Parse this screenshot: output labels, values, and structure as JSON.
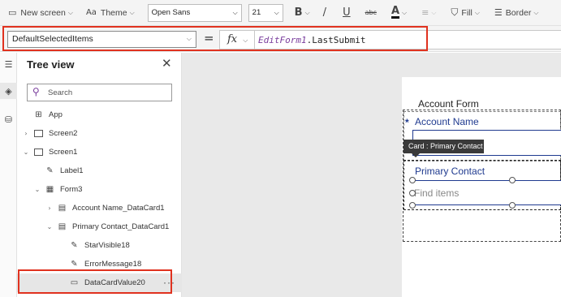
{
  "toolbar": {
    "new_screen": "New screen",
    "theme": "Theme",
    "font_name": "Open Sans",
    "font_size": "21",
    "bold_glyph": "B",
    "italic_glyph": "/",
    "underline_glyph": "U",
    "strike_glyph": "abc",
    "font_color_glyph": "A",
    "fill": "Fill",
    "border": "Border"
  },
  "formula_bar": {
    "property": "DefaultSelectedItems",
    "equals": "=",
    "fx_label": "fx",
    "formula_identifier": "EditForm1",
    "formula_rest": ".LastSubmit"
  },
  "tree_view": {
    "title": "Tree view",
    "search_placeholder": "Search",
    "items": [
      {
        "label": "App",
        "icon": "app-icon",
        "level": 0,
        "chevron": ""
      },
      {
        "label": "Screen2",
        "icon": "screen-icon",
        "level": 0,
        "chevron": "›"
      },
      {
        "label": "Screen1",
        "icon": "screen-icon",
        "level": 0,
        "chevron": "⌄"
      },
      {
        "label": "Label1",
        "icon": "label-icon",
        "level": 1,
        "chevron": ""
      },
      {
        "label": "Form3",
        "icon": "form-icon",
        "level": 1,
        "chevron": "⌄"
      },
      {
        "label": "Account Name_DataCard1",
        "icon": "card-icon",
        "level": 2,
        "chevron": "›"
      },
      {
        "label": "Primary Contact_DataCard1",
        "icon": "card-icon",
        "level": 2,
        "chevron": "⌄"
      },
      {
        "label": "StarVisible18",
        "icon": "label-icon",
        "level": 3,
        "chevron": ""
      },
      {
        "label": "ErrorMessage18",
        "icon": "label-icon",
        "level": 3,
        "chevron": ""
      },
      {
        "label": "DataCardValue20",
        "icon": "combobox-icon",
        "level": 3,
        "chevron": "",
        "selected": true
      }
    ],
    "more": "···"
  },
  "canvas": {
    "form_title": "Account Form",
    "required_star": "*",
    "account_name_label": "Account Name",
    "tooltip": "Card : Primary Contact",
    "primary_contact_label": "Primary Contact",
    "combo_placeholder": "Find items"
  },
  "colors": {
    "highlight_red": "#e0321f",
    "label_blue": "#1f3a8f",
    "formula_purple": "#7a3e9d"
  }
}
